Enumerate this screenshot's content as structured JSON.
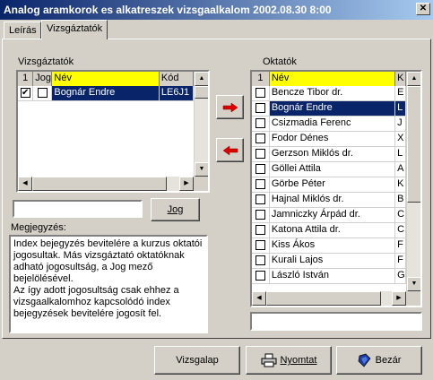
{
  "window": {
    "title": "Analog aramkorok es alkatreszek vizsgaalkalom 2002.08.30 8:00",
    "close_glyph": "✕"
  },
  "tabs": [
    {
      "label": "Leírás"
    },
    {
      "label": "Vizsgáztatók"
    }
  ],
  "left": {
    "group_label": "Vizsgáztatók",
    "headers": {
      "num": "1",
      "jog": "Jog",
      "nev": "Név",
      "kod": "Kód"
    },
    "rows": [
      {
        "nev": "Bognár Endre",
        "kod": "LE6J1",
        "checked": true,
        "jog": false
      }
    ],
    "input_value": "",
    "jog_button": "Jog",
    "note_label": "Megjegyzés:",
    "note_text": "Index bejegyzés bevitelére a kurzus oktatói jogosultak. Más vizsgáztató oktatóknak adható jogosultság, a Jog mező bejelölésével.\nAz így adott jogosultság csak ehhez a vizsgaalkalomhoz kapcsolódó index bejegyzések bevitelére jogosít fel."
  },
  "right": {
    "group_label": "Oktatók",
    "headers": {
      "num": "1",
      "nev": "Név",
      "k": "K"
    },
    "rows": [
      {
        "nev": "Bencze Tibor dr.",
        "k": "E"
      },
      {
        "nev": "Bognár Endre",
        "k": "L"
      },
      {
        "nev": "Csizmadia Ferenc",
        "k": "J"
      },
      {
        "nev": "Fodor Dénes",
        "k": "X"
      },
      {
        "nev": "Gerzson Miklós dr.",
        "k": "L"
      },
      {
        "nev": "Göllei Attila",
        "k": "A"
      },
      {
        "nev": "Görbe Péter",
        "k": "K"
      },
      {
        "nev": "Hajnal Miklós dr.",
        "k": "B"
      },
      {
        "nev": "Jamniczky Árpád dr.",
        "k": "C"
      },
      {
        "nev": "Katona Attila dr.",
        "k": "C"
      },
      {
        "nev": "Kiss Ákos",
        "k": "F"
      },
      {
        "nev": "Kurali Lajos",
        "k": "F"
      },
      {
        "nev": "László István",
        "k": "G"
      }
    ],
    "selected_index": 1,
    "input_value": ""
  },
  "arrows": {
    "add_icon": "arrow-right-red",
    "remove_icon": "arrow-left-red"
  },
  "footer": {
    "vizsgalap": "Vizsgalap",
    "nyomtat": "Nyomtat",
    "bezar": "Bezár"
  },
  "colors": {
    "title_start": "#0a246a",
    "title_end": "#a6caf0",
    "header_yellow": "#ffff00",
    "selection": "#0a246a",
    "arrow_red": "#e00000"
  }
}
